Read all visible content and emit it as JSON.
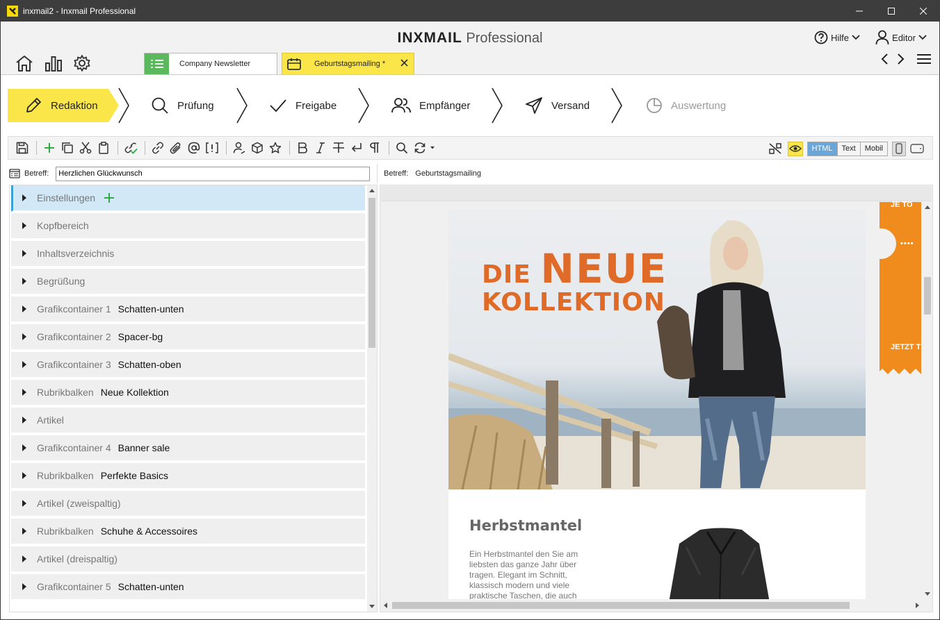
{
  "window": {
    "title": "inxmail2 - Inxmail Professional"
  },
  "header": {
    "brand_bold": "INXMAIL",
    "brand_light": "Professional",
    "help_label": "Hilfe",
    "user_label": "Editor"
  },
  "tabs": [
    {
      "label": "Company Newsletter",
      "icon": "list-icon",
      "color": "#5cb85c"
    },
    {
      "label": "Geburtstagsmailing *",
      "icon": "calendar-icon",
      "color": "#fbe64a"
    }
  ],
  "workflow": {
    "steps": [
      {
        "label": "Redaktion",
        "icon": "pencil-icon",
        "state": "active"
      },
      {
        "label": "Prüfung",
        "icon": "search-icon",
        "state": "normal"
      },
      {
        "label": "Freigabe",
        "icon": "check-icon",
        "state": "normal"
      },
      {
        "label": "Empfänger",
        "icon": "users-icon",
        "state": "normal"
      },
      {
        "label": "Versand",
        "icon": "send-icon",
        "state": "normal"
      },
      {
        "label": "Auswertung",
        "icon": "pie-chart-icon",
        "state": "disabled"
      }
    ],
    "accent": "#fbe64a"
  },
  "toolbar": {
    "views": [
      "HTML",
      "Text",
      "Mobil"
    ],
    "active_view": "HTML"
  },
  "subject": {
    "label": "Betreff:",
    "value": "Herzlichen Glückwunsch",
    "preview_label": "Betreff:",
    "preview_value": "Geburtstagsmailing"
  },
  "structure": {
    "rows": [
      {
        "type": "Einstellungen",
        "value": "",
        "selected": true
      },
      {
        "type": "Kopfbereich",
        "value": ""
      },
      {
        "type": "Inhaltsverzeichnis",
        "value": ""
      },
      {
        "type": "Begrüßung",
        "value": ""
      },
      {
        "type": "Grafikcontainer 1",
        "value": "Schatten-unten"
      },
      {
        "type": "Grafikcontainer 2",
        "value": "Spacer-bg"
      },
      {
        "type": "Grafikcontainer 3",
        "value": "Schatten-oben"
      },
      {
        "type": "Rubrikbalken",
        "value": "Neue Kollektion"
      },
      {
        "type": "Artikel",
        "value": ""
      },
      {
        "type": "Grafikcontainer 4",
        "value": "Banner sale"
      },
      {
        "type": "Rubrikbalken",
        "value": "Perfekte Basics"
      },
      {
        "type": "Artikel (zweispaltig)",
        "value": ""
      },
      {
        "type": "Rubrikbalken",
        "value": "Schuhe & Accessoires"
      },
      {
        "type": "Artikel (dreispaltig)",
        "value": ""
      },
      {
        "type": "Grafikcontainer 5",
        "value": "Schatten-unten"
      }
    ]
  },
  "preview": {
    "headline_small": "DIE",
    "headline_big": "NEUE",
    "headline_line2": "KOLLEKTION",
    "headline_color": "#e06a28",
    "article_title": "Herbstmantel",
    "article_text": "Ein Herbstmantel den Sie am liebsten das ganze Jahr über tragen. Elegant im Schnitt, klassisch modern und viele praktische Taschen, die auch",
    "ribbon_top": "JE TO",
    "ribbon_dots": "• • • •",
    "ribbon_bottom": "JETZT T",
    "ribbon_color": "#f08c1e"
  }
}
